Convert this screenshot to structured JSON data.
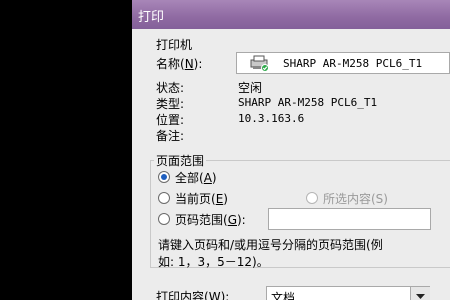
{
  "window": {
    "title": "打印"
  },
  "printer_group": {
    "title": "打印机",
    "name_label": "名称(",
    "name_key": "N",
    "name_label_end": "):",
    "selected_printer": "SHARP AR-M258 PCL6_T1",
    "status_label": "状态:",
    "status_value": "空闲",
    "type_label": "类型:",
    "type_value": "SHARP AR-M258 PCL6_T1",
    "location_label": "位置:",
    "location_value": "10.3.163.6",
    "comment_label": "备注:"
  },
  "page_range": {
    "title": "页面范围",
    "all_label": "全部(",
    "all_key": "A",
    "all_end": ")",
    "current_label": "当前页(",
    "current_key": "E",
    "current_end": ")",
    "selection_label": "所选内容(S)",
    "pages_label": "页码范围(",
    "pages_key": "G",
    "pages_end": "):",
    "pages_value": "",
    "hint_line1": "请键入页码和/或用逗号分隔的页码范围(例",
    "hint_line2": "如: 1，3，5－12)。",
    "selected": "all"
  },
  "print_what": {
    "label": "打印内容(",
    "key": "W",
    "label_end": "):",
    "value": "文档"
  }
}
